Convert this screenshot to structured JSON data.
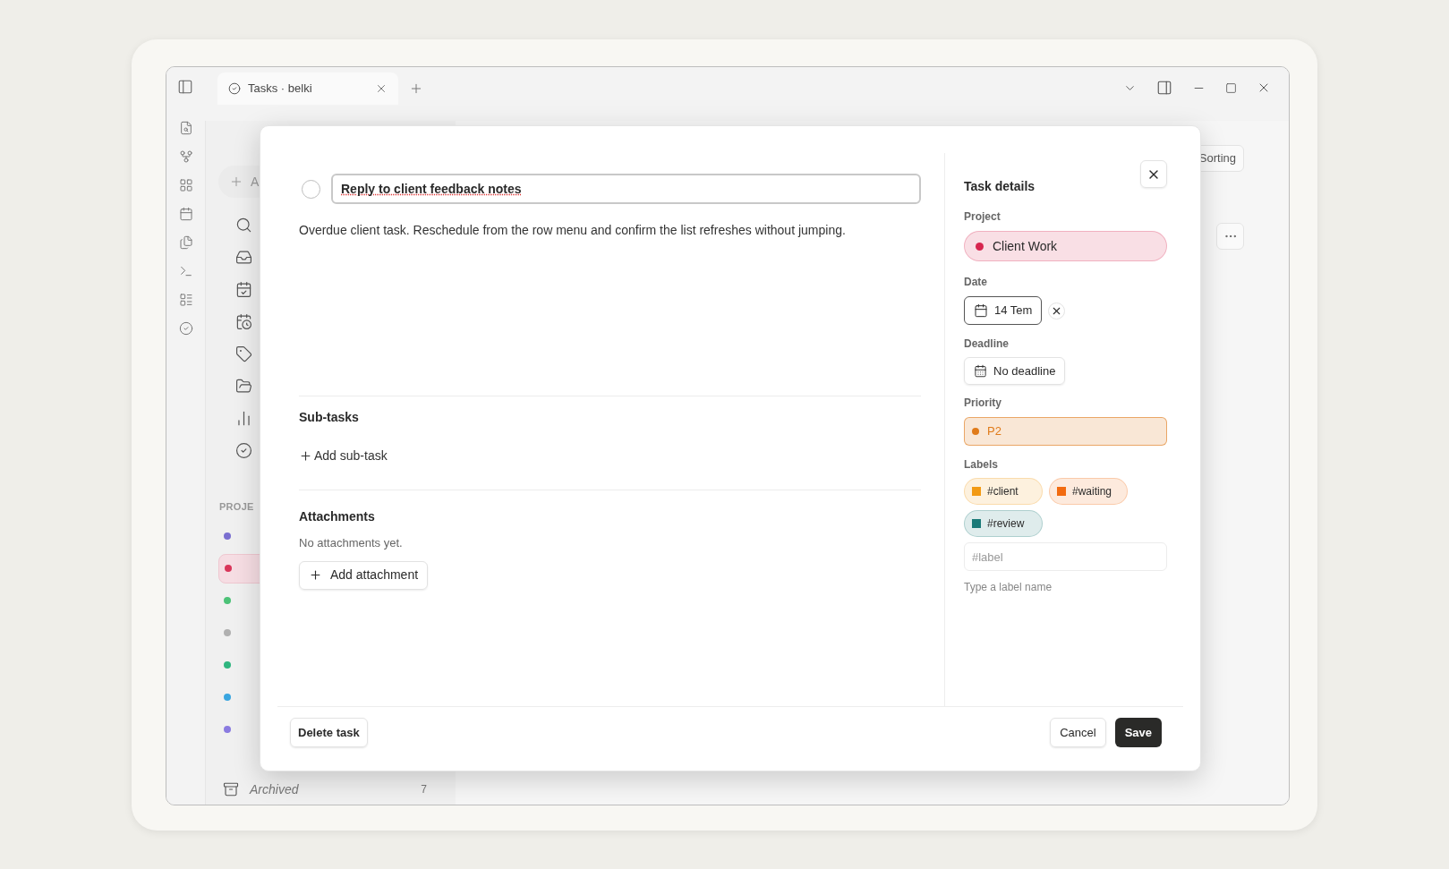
{
  "window": {
    "tab": {
      "title": "Tasks · belki"
    }
  },
  "sidebar": {
    "add_label": "A",
    "section_label": "PROJE",
    "projects": [
      {
        "color": "#7a6fd0",
        "selected": false
      },
      {
        "color": "#d9365a",
        "selected": true
      },
      {
        "color": "#4cc277",
        "selected": false
      },
      {
        "color": "#b0b0b0",
        "selected": false
      },
      {
        "color": "#2fb57f",
        "selected": false
      },
      {
        "color": "#3aa6e0",
        "selected": false
      },
      {
        "color": "#8a7be0",
        "selected": false
      }
    ],
    "archived": {
      "label": "Archived",
      "count": "7"
    }
  },
  "main": {
    "sorting_button": "Sorting"
  },
  "task_dialog": {
    "completed": false,
    "title": "Reply to client feedback notes",
    "description": "Overdue client task. Reschedule from the row menu and confirm the list refreshes without jumping.",
    "subtasks": {
      "heading": "Sub-tasks",
      "add_label": "Add sub-task"
    },
    "attachments": {
      "heading": "Attachments",
      "empty_text": "No attachments yet.",
      "add_label": "Add attachment"
    },
    "details": {
      "heading": "Task details",
      "project": {
        "label": "Project",
        "value": "Client Work",
        "color": "#d7264f"
      },
      "date": {
        "label": "Date",
        "value": "14 Tem"
      },
      "deadline": {
        "label": "Deadline",
        "value": "No deadline"
      },
      "priority": {
        "label": "Priority",
        "value": "P2",
        "color": "#e07b1a"
      },
      "labels": {
        "label": "Labels",
        "items": [
          {
            "name": "#client",
            "color": "#f29a14"
          },
          {
            "name": "#waiting",
            "color": "#f26b10"
          },
          {
            "name": "#review",
            "color": "#1a7a78"
          }
        ],
        "placeholder": "#label",
        "hint": "Type a label name"
      }
    },
    "buttons": {
      "delete": "Delete task",
      "cancel": "Cancel",
      "save": "Save"
    }
  }
}
